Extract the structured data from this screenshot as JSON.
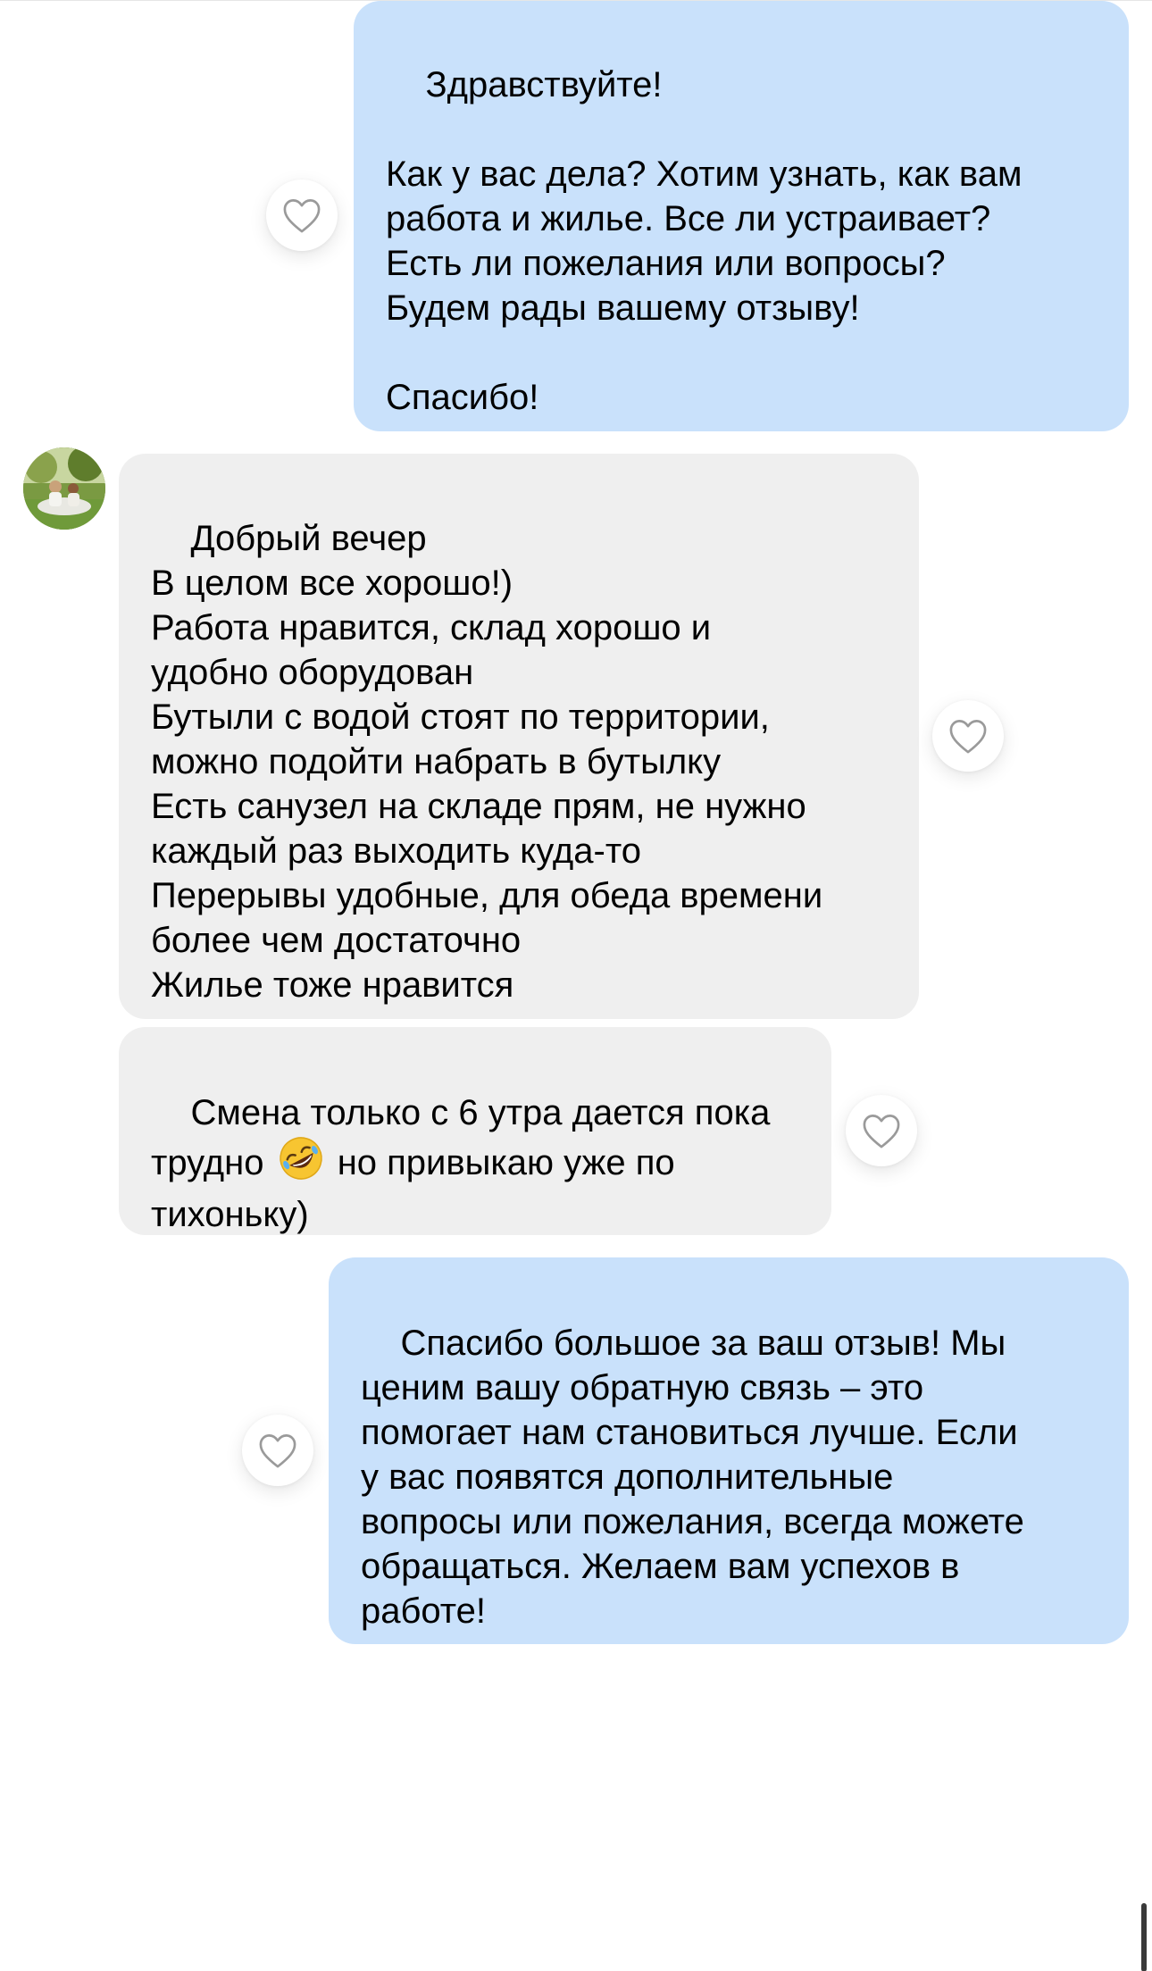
{
  "theme": {
    "outgoing_bubble_color": "#c9e1fb",
    "incoming_bubble_color": "#efefef",
    "like_icon_color": "#9a9a9a"
  },
  "messages": [
    {
      "direction": "outgoing",
      "text": "Здравствуйте!\n\nКак у вас дела? Хотим узнать, как вам\nработа и жилье. Все ли устраивает?\nЕсть ли пожелания или вопросы?\nБудем рады вашему отзыву!\n\nСпасибо!"
    },
    {
      "direction": "incoming",
      "text": "Добрый вечер\nВ целом все хорошо!)\nРабота нравится, склад хорошо и\nудобно оборудован\nБутыли с водой стоят по территории,\nможно подойти набрать в бутылку\nЕсть санузел на складе прям, не нужно\nкаждый раз выходить куда-то\nПерерывы удобные, для обеда времени\nболее чем достаточно\nЖилье тоже нравится"
    },
    {
      "direction": "incoming",
      "text_before_emoji": "Смена только с 6 утра дается пока\nтрудно ",
      "emoji": "rolling-on-floor-laughing",
      "text_after_emoji": " но привыкаю уже по\nтихоньку)"
    },
    {
      "direction": "outgoing",
      "text": "Спасибо большое за ваш отзыв! Мы\nценим вашу обратную связь – это\nпомогает нам становиться лучше. Если\nу вас появятся дополнительные\nвопросы или пожелания, всегда можете\nобращаться. Желаем вам успехов в\nработе!"
    }
  ],
  "icons": {
    "like": "heart-outline-icon",
    "avatar": "user-avatar"
  }
}
